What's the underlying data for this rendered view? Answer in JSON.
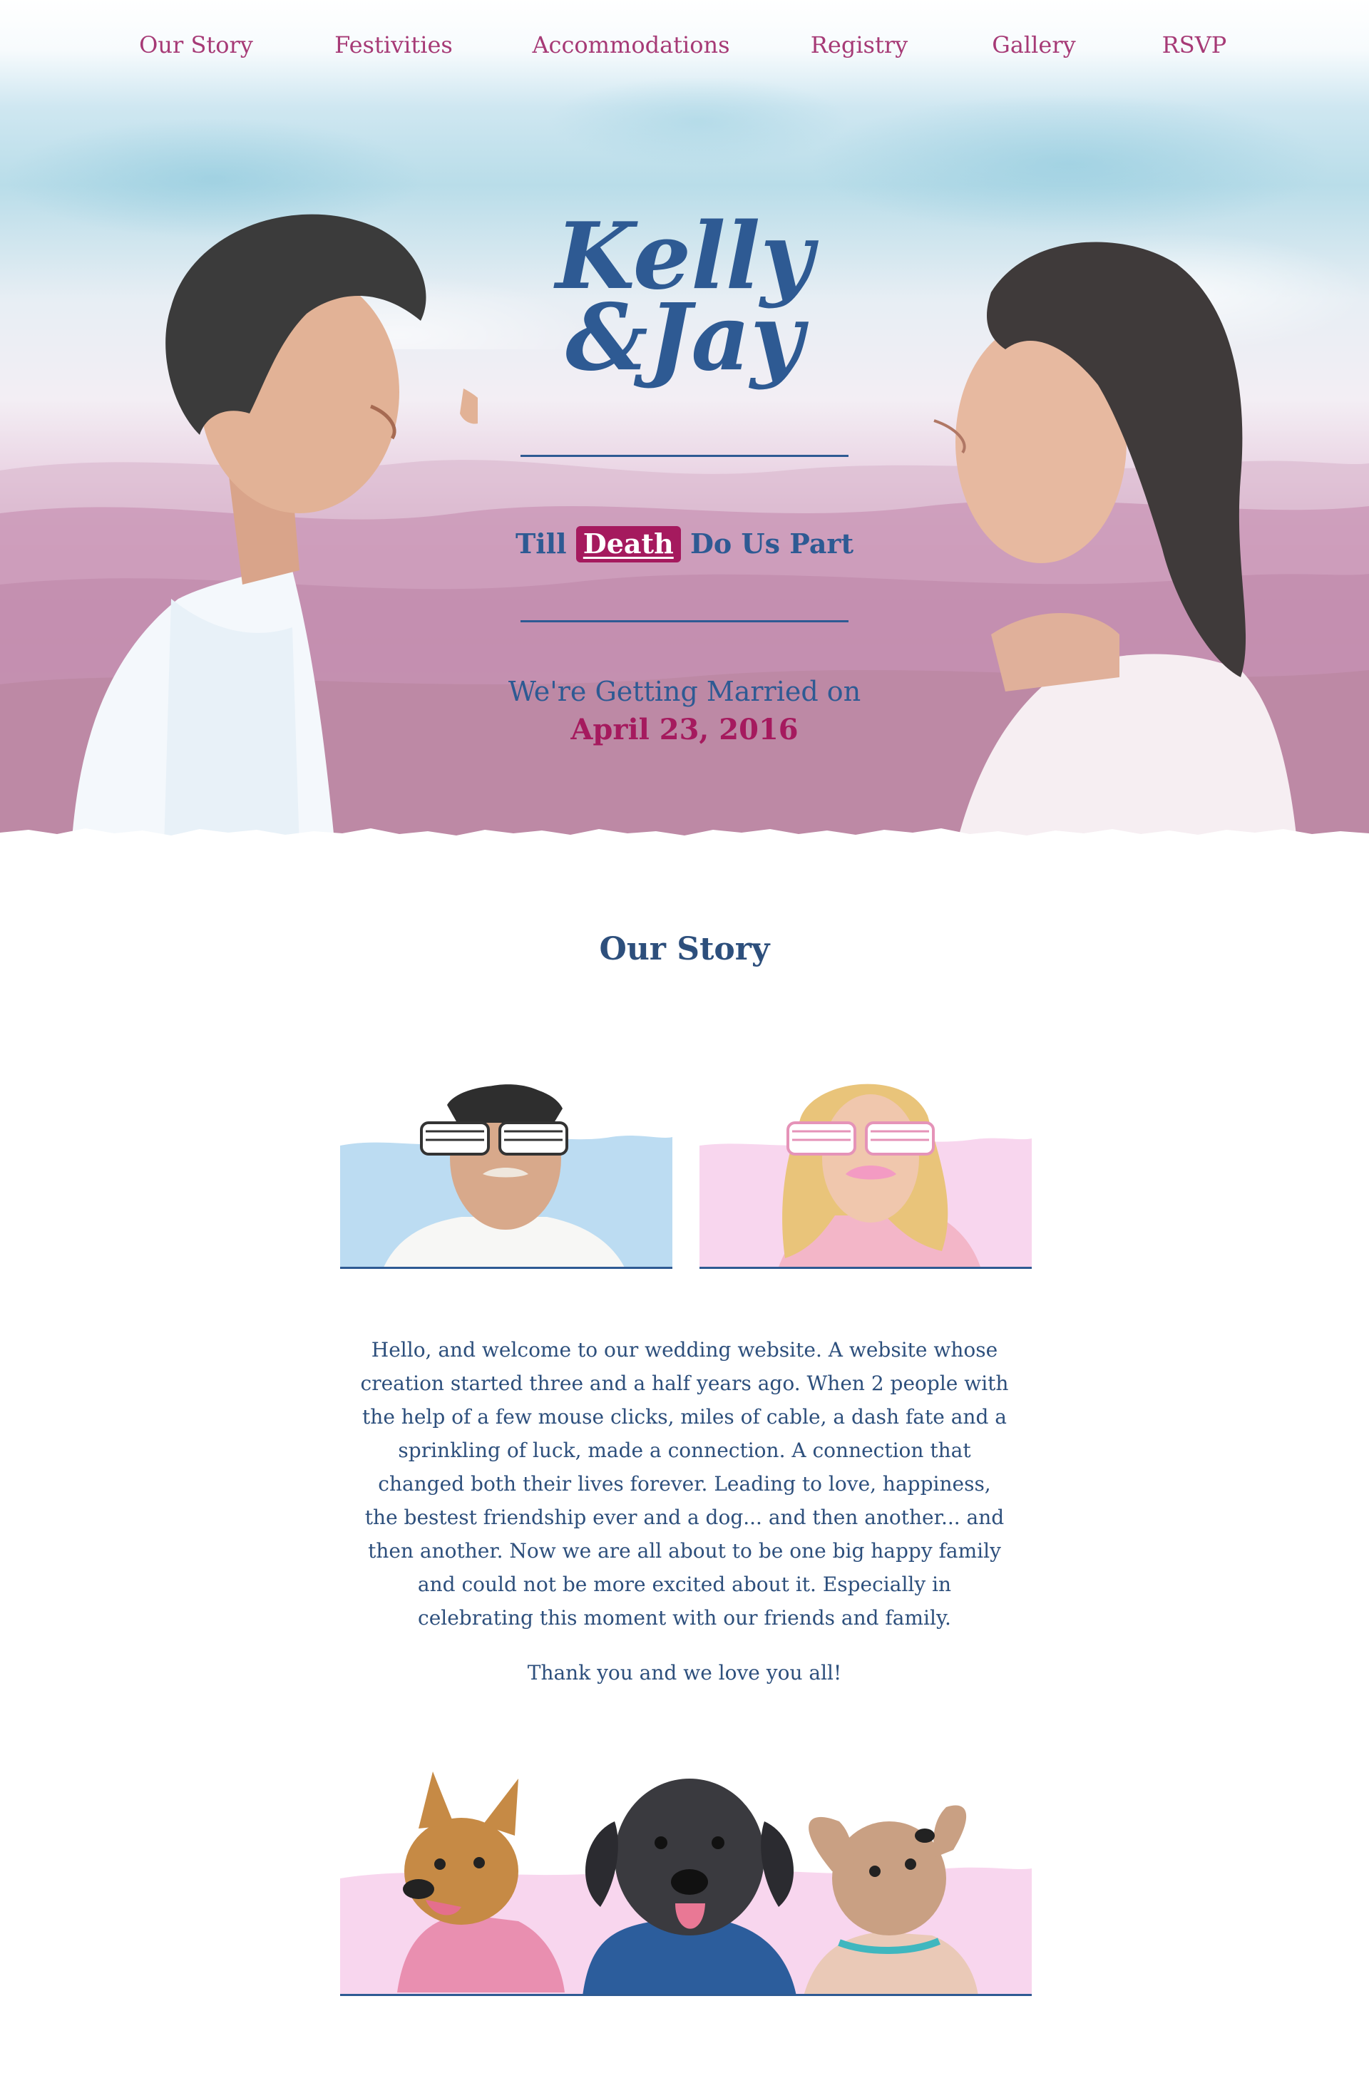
{
  "nav": {
    "items": [
      {
        "label": "Our Story"
      },
      {
        "label": "Festivities"
      },
      {
        "label": "Accommodations"
      },
      {
        "label": "Registry"
      },
      {
        "label": "Gallery"
      },
      {
        "label": "RSVP"
      }
    ]
  },
  "hero": {
    "name_line1": "Kelly",
    "name_line2": "&Jay",
    "tagline_before": "Till",
    "tagline_highlight": "Death",
    "tagline_after": "Do Us Part",
    "date_intro": "We're Getting Married on",
    "date": "April 23, 2016"
  },
  "story": {
    "title": "Our Story",
    "paragraph": "Hello, and welcome to our wedding website. A website whose creation started three and a half years ago. When 2 people with the help of a few mouse clicks, miles of cable, a dash fate and a sprinkling of luck, made a connection.  A connection that changed both their lives forever. Leading to love, happiness, the bestest friendship ever and a dog... and then another... and then another. Now we are all about to be one big happy family and could not be more excited about it. Especially in celebrating this moment with our friends and family.",
    "thanks": "Thank you and we love you all!"
  },
  "colors": {
    "nav_link": "#a63a76",
    "heading_blue": "#2d4f7c",
    "accent_magenta": "#a51a5e",
    "sky_blue": "#b9dde9",
    "lavender": "#d4a8c2"
  }
}
